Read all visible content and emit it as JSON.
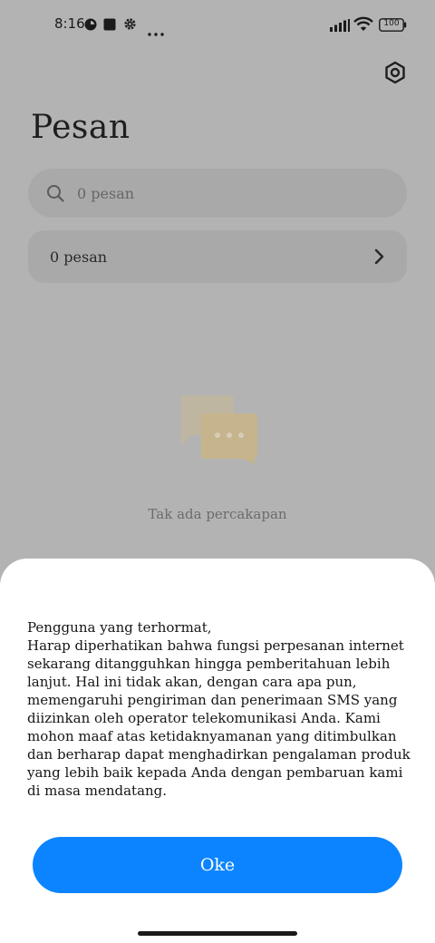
{
  "status_bar": {
    "time": "8:16",
    "battery": "100",
    "icons": [
      "app-notification-icon",
      "square-notification-icon",
      "gear-notification-icon",
      "more-dots-icon",
      "signal-icon",
      "wifi-icon",
      "battery-icon"
    ]
  },
  "header": {
    "title": "Pesan",
    "settings_icon": "settings-hexagon-icon"
  },
  "search": {
    "placeholder": "0 pesan"
  },
  "folder": {
    "label": "0 pesan"
  },
  "empty_state": {
    "text": "Tak ada percakapan",
    "illustration": "chat-bubbles-icon"
  },
  "dialog": {
    "message": "Pengguna yang terhormat,\nHarap diperhatikan bahwa fungsi perpesanan internet sekarang ditangguhkan hingga pemberitahuan lebih lanjut. Hal ini tidak akan, dengan cara apa pun, memengaruhi pengiriman dan penerimaan SMS yang diizinkan oleh operator telekomunikasi Anda. Kami mohon maaf atas ketidaknyamanan yang ditimbulkan dan berharap dapat menghadirkan pengalaman produk yang lebih baik kepada Anda dengan pembaruan kami di masa mendatang.",
    "ok_label": "Oke"
  },
  "colors": {
    "overlay_background": "#b3b3b3",
    "accent": "#0d84ff",
    "sheet": "#ffffff"
  }
}
